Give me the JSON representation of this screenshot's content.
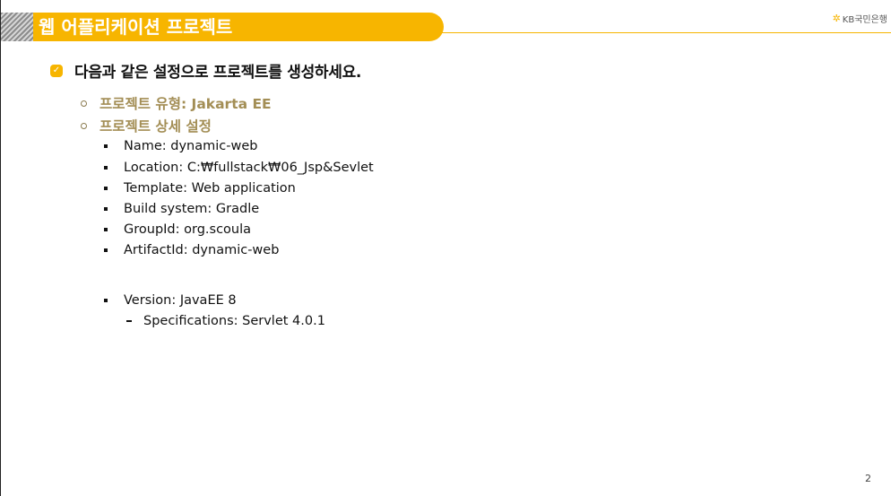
{
  "header": {
    "title": "웹 어플리케이션 프로젝트",
    "logo_text": "KB국민은행",
    "accent_color": "#f7b500"
  },
  "content": {
    "main_point": "다음과 같은 설정으로 프로젝트를 생성하세요.",
    "sub_points": [
      "프로젝트 유형: Jakarta EE",
      "프로젝트 상세 설정"
    ],
    "settings": [
      "Name: dynamic-web",
      "Location: C:₩fullstack₩06_Jsp&Sevlet",
      "Template: Web application",
      "Build system: Gradle",
      "GroupId: org.scoula",
      "ArtifactId: dynamic-web"
    ],
    "version": "Version: JavaEE 8",
    "specifications": "Specifications: Servlet 4.0.1"
  },
  "footer": {
    "page_number": "2"
  }
}
